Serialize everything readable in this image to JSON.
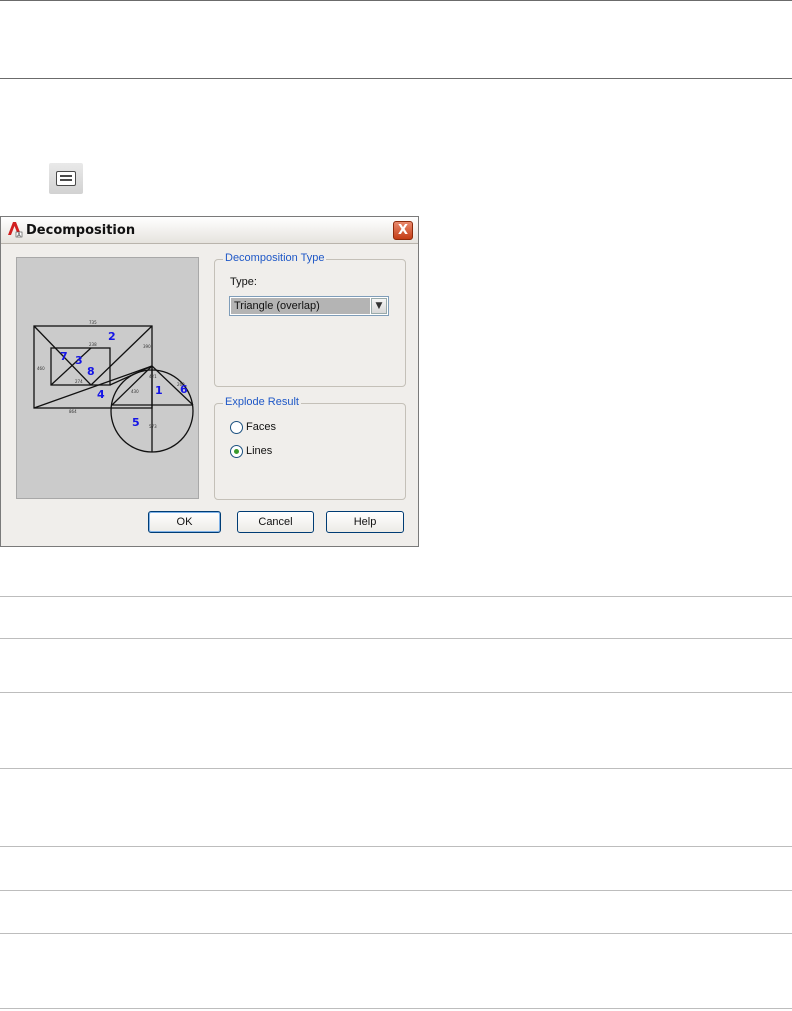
{
  "dialog": {
    "title": "Decomposition",
    "close_label": "X",
    "decomposition_type": {
      "legend": "Decomposition Type",
      "type_label": "Type:",
      "type_value": "Triangle (overlap)"
    },
    "explode_result": {
      "legend": "Explode Result",
      "options": [
        {
          "label": "Faces",
          "selected": false
        },
        {
          "label": "Lines",
          "selected": true
        }
      ]
    },
    "buttons": {
      "ok": "OK",
      "cancel": "Cancel",
      "help": "Help"
    },
    "preview": {
      "region_numbers": [
        "1",
        "2",
        "3",
        "4",
        "5",
        "6",
        "7",
        "8"
      ]
    }
  },
  "colors": {
    "legend_text": "#1f58c7",
    "region_number": "#1515e6",
    "dialog_bg": "#f0eeeb",
    "preview_bg": "#cbcbcb"
  },
  "icons": [
    "dialog-tool-icon",
    "app-logo-icon",
    "close-icon",
    "chevron-down-icon"
  ]
}
